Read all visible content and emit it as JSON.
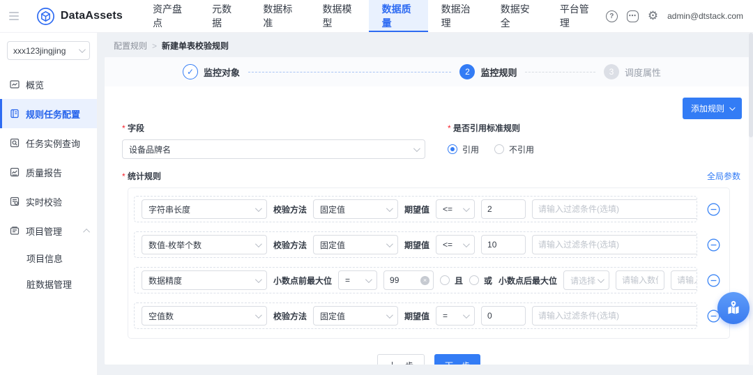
{
  "navbar": {
    "brand": "DataAssets",
    "items": [
      {
        "label": "资产盘点"
      },
      {
        "label": "元数据"
      },
      {
        "label": "数据标准"
      },
      {
        "label": "数据模型"
      },
      {
        "label": "数据质量",
        "active": true
      },
      {
        "label": "数据治理"
      },
      {
        "label": "数据安全"
      },
      {
        "label": "平台管理"
      }
    ],
    "icons": {
      "help": "?",
      "message": "⋯",
      "settings": "⚙"
    },
    "user_email": "admin@dtstack.com"
  },
  "sidebar": {
    "project": "xxx123jingjing",
    "items": [
      {
        "label": "概览",
        "icon": "overview-icon"
      },
      {
        "label": "规则任务配置",
        "icon": "rule-config-icon",
        "active": true
      },
      {
        "label": "任务实例查询",
        "icon": "task-query-icon"
      },
      {
        "label": "质量报告",
        "icon": "quality-report-icon"
      },
      {
        "label": "实时校验",
        "icon": "realtime-check-icon"
      },
      {
        "label": "项目管理",
        "icon": "project-manage-icon",
        "expanded": true
      }
    ],
    "sub_items": [
      {
        "label": "项目信息"
      },
      {
        "label": "脏数据管理"
      }
    ]
  },
  "breadcrumb": {
    "parent": "配置规则",
    "separator": ">",
    "current": "新建单表校验规则"
  },
  "stepper": {
    "steps": [
      {
        "label": "监控对象",
        "state": "done",
        "glyph": "✓"
      },
      {
        "label": "监控规则",
        "state": "active",
        "number": "2"
      },
      {
        "label": "调度属性",
        "state": "pending",
        "number": "3"
      }
    ]
  },
  "toolbar": {
    "add_rule_label": "添加规则"
  },
  "form": {
    "field_label": "字段",
    "field_value": "设备品牌名",
    "ref_label": "是否引用标准规则",
    "ref_options": [
      {
        "label": "引用",
        "selected": true
      },
      {
        "label": "不引用",
        "selected": false
      }
    ],
    "stats_label": "统计规则",
    "global_params_label": "全局参数"
  },
  "rules": [
    {
      "type": "字符串长度",
      "method_label": "校验方法",
      "method": "固定值",
      "expect_label": "期望值",
      "operator": "<=",
      "value": "2",
      "filter_placeholder": "请输入过滤条件(选填)"
    },
    {
      "type": "数值-枚举个数",
      "method_label": "校验方法",
      "method": "固定值",
      "expect_label": "期望值",
      "operator": "<=",
      "value": "10",
      "filter_placeholder": "请输入过滤条件(选填)"
    },
    {
      "type": "数据精度",
      "pre_label": "小数点前最大位",
      "operator": "=",
      "value": "99",
      "and_label": "且",
      "or_label": "或",
      "post_label": "小数点后最大位",
      "select_placeholder": "请选择",
      "number_placeholder": "请输入数值",
      "filter_placeholder": "请输入过滤条件(选填)"
    },
    {
      "type": "空值数",
      "method_label": "校验方法",
      "method": "固定值",
      "expect_label": "期望值",
      "operator": "=",
      "value": "0",
      "filter_placeholder": "请输入过滤条件(选填)"
    }
  ],
  "footer": {
    "prev_label": "上一步",
    "next_label": "下一步"
  },
  "colors": {
    "primary": "#337CF5",
    "nav_active_bg": "#E9F1FE",
    "sidebar_active_bg": "#EAF1FE"
  }
}
